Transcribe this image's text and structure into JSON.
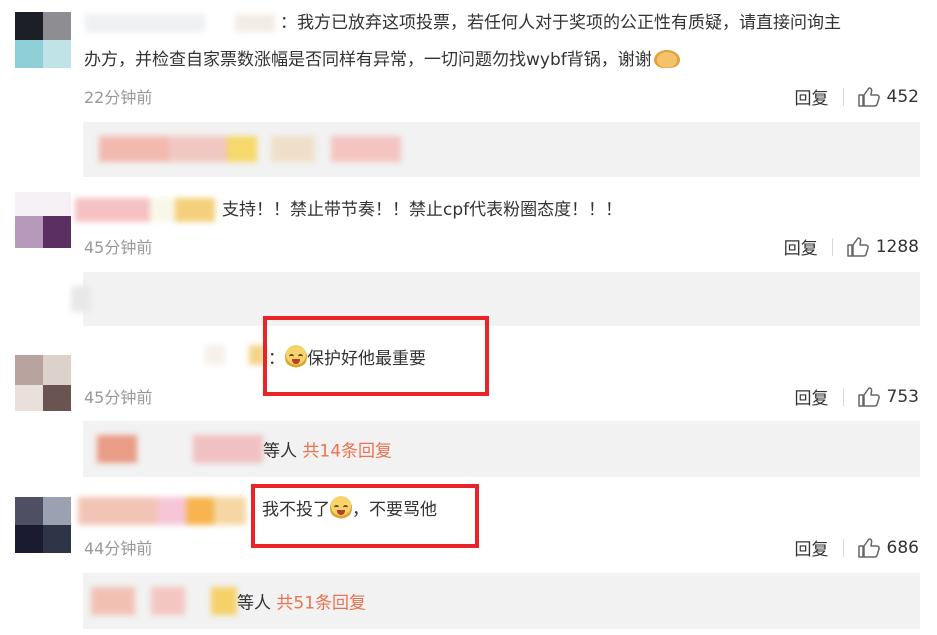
{
  "comments": [
    {
      "text_line1": "：我方已放弃这项投票，若任何人对于奖项的公正性有质疑，请直接问询主",
      "text_line2": "办方，并检查自家票数涨幅是否同样有异常，一切问题勿找wybf背锅，谢谢",
      "line2_emoji": "handshake-emoji",
      "time": "22分钟前",
      "reply_label": "回复",
      "likes": "452"
    },
    {
      "text": "支持！！禁止带节奏！！禁止cpf代表粉圈态度！！！",
      "time": "45分钟前",
      "reply_label": "回复",
      "likes": "1288"
    },
    {
      "prefix": "：",
      "emoji": "crying-face-emoji",
      "text": "保护好他最重要",
      "time": "45分钟前",
      "reply_label": "回复",
      "likes": "753",
      "subreplies": {
        "suffix": "等人",
        "link": "共14条回复"
      }
    },
    {
      "text_before": "我不投了",
      "emoji": "crying-face-emoji",
      "text_after": "，不要骂他",
      "time": "44分钟前",
      "reply_label": "回复",
      "likes": "686",
      "subreplies": {
        "suffix": "等人",
        "link": "共51条回复"
      }
    }
  ],
  "colors": {
    "highlight_border": "#e8242a",
    "subreply_link": "#eb7350",
    "subreply_bg": "#f2f2f2",
    "time_text": "#999999"
  }
}
